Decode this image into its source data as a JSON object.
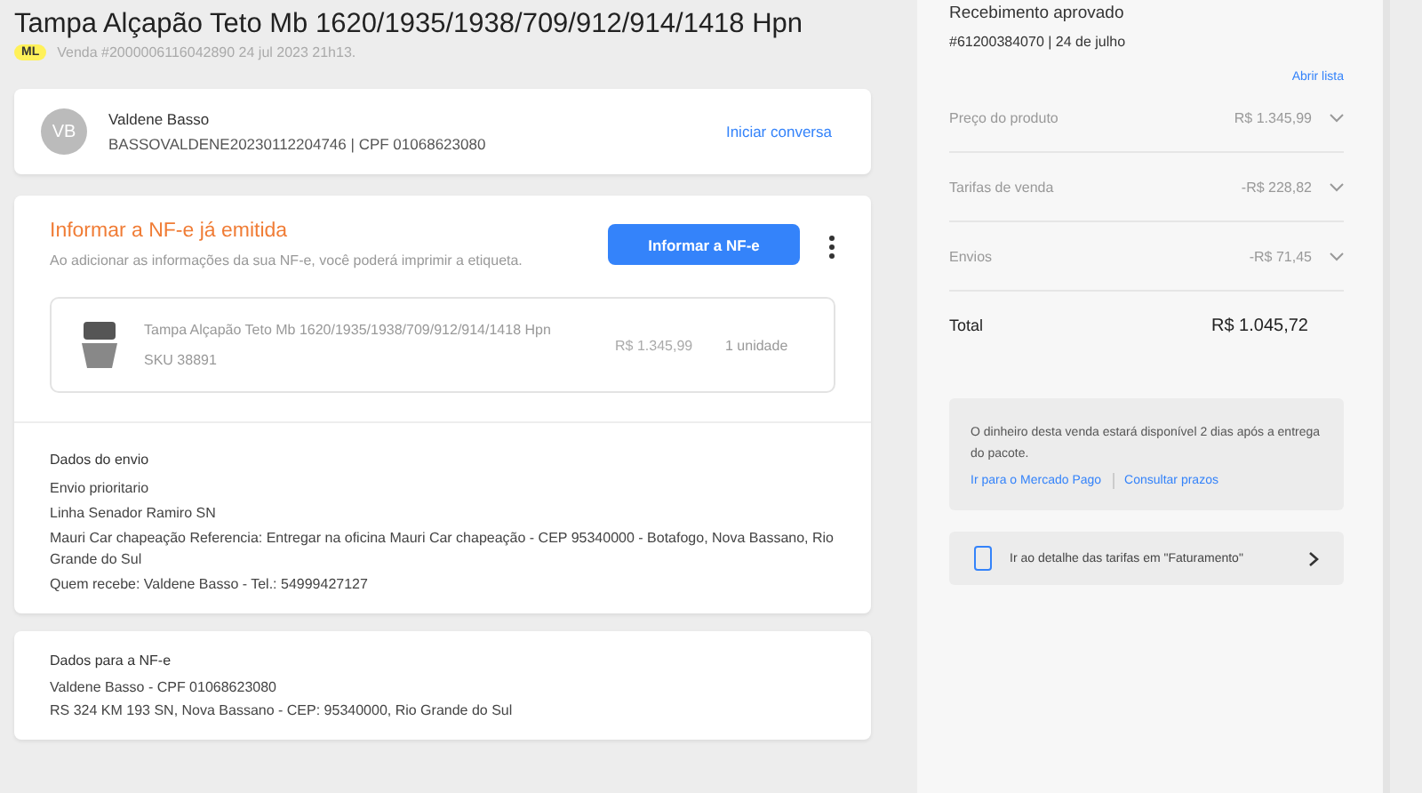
{
  "header": {
    "title": "Tampa Alçapão Teto Mb 1620/1935/1938/709/912/914/1418 Hpn",
    "badge": "ML",
    "sale_info": "Venda #2000006116042890 24 jul 2023 21h13."
  },
  "buyer": {
    "initials": "VB",
    "name": "Valdene Basso",
    "details": "BASSOVALDENE20230112204746 | CPF 01068623080",
    "action": "Iniciar conversa"
  },
  "nfe": {
    "title": "Informar a NF-e já emitida",
    "description": "Ao adicionar as informações da sua NF-e, você poderá imprimir a etiqueta.",
    "button": "Informar a NF-e"
  },
  "product": {
    "name": "Tampa Alçapão Teto Mb 1620/1935/1938/709/912/914/1418 Hpn",
    "sku": "SKU 38891",
    "price": "R$ 1.345,99",
    "quantity": "1 unidade"
  },
  "shipping": {
    "title": "Dados do envio",
    "lines": [
      "Envio prioritario",
      "Linha Senador Ramiro SN",
      "Mauri Car chapeação Referencia: Entregar na oficina Mauri Car chapeação - CEP 95340000 - Botafogo, Nova Bassano, Rio Grande do Sul",
      "Quem recebe: Valdene Basso - Tel.: 54999427127"
    ]
  },
  "invoice_data": {
    "title": "Dados para a NF-e",
    "lines": [
      "Valdene Basso - CPF 01068623080",
      "RS 324 KM 193 SN, Nova Bassano - CEP: 95340000, Rio Grande do Sul"
    ]
  },
  "payment": {
    "title": "Recebimento aprovado",
    "subtitle": "#61200384070 | 24 de julho",
    "open_list": "Abrir lista",
    "rows": [
      {
        "label": "Preço do produto",
        "value": "R$ 1.345,99"
      },
      {
        "label": "Tarifas de venda",
        "value": "-R$ 228,82"
      },
      {
        "label": "Envios",
        "value": "-R$ 71,45"
      }
    ],
    "total_label": "Total",
    "total_value": "R$ 1.045,72",
    "notice": "O dinheiro desta venda estará disponível 2 dias após a entrega do pacote.",
    "links": [
      "Ir para o Mercado Pago",
      "Consultar prazos"
    ],
    "billing_link": "Ir ao detalhe das tarifas em \"Faturamento\""
  }
}
